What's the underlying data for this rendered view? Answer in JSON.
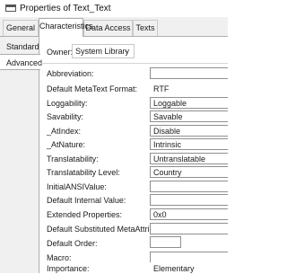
{
  "window": {
    "title": "Properties of Text_Text"
  },
  "tabs": [
    "General",
    "Characteristics",
    "Data Access",
    "Texts"
  ],
  "side_tabs": [
    "Standard",
    "Advanced"
  ],
  "owner": {
    "label": "Owner:",
    "value": "System Library"
  },
  "properties": [
    {
      "label": "Abbreviation:",
      "value": ""
    },
    {
      "label": "Default MetaText Format:",
      "value": "RTF"
    },
    {
      "label": "Loggability:",
      "value": "Loggable"
    },
    {
      "label": "Savability:",
      "value": "Savable"
    },
    {
      "label": "_AtIndex:",
      "value": "Disable"
    },
    {
      "label": "_AtNature:",
      "value": "Intrinsic"
    },
    {
      "label": "Translatability:",
      "value": "Untranslatable"
    },
    {
      "label": "Translatability Level:",
      "value": "Country"
    },
    {
      "label": "InitialANSIValue:",
      "value": ""
    },
    {
      "label": "Default Internal Value:",
      "value": ""
    },
    {
      "label": "Extended Properties:",
      "value": "0x0"
    },
    {
      "label": "Default Substituted MetaAttribute:",
      "value": ""
    },
    {
      "label": "Default Order:",
      "value": ""
    },
    {
      "label": "Macro:",
      "value": ""
    },
    {
      "label": "Importance:",
      "value": "Elementary"
    }
  ]
}
